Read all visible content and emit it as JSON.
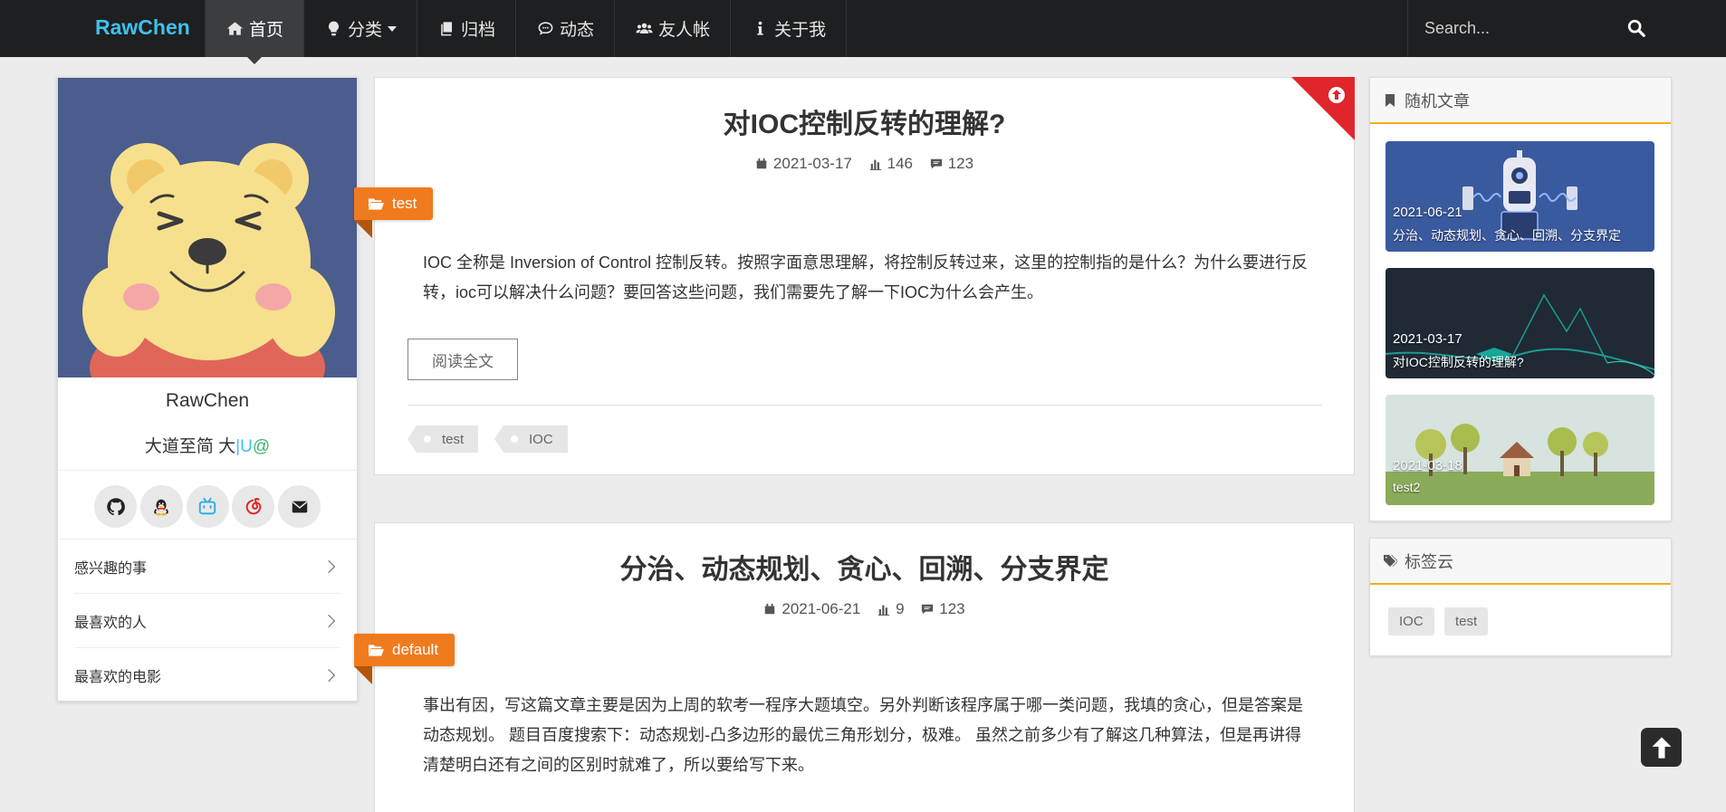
{
  "navbar": {
    "brand": "RawChen",
    "items": [
      {
        "label": "首页",
        "icon": "home-icon",
        "active": true
      },
      {
        "label": "分类",
        "icon": "lightbulb-icon",
        "dropdown": true
      },
      {
        "label": "归档",
        "icon": "archive-icon"
      },
      {
        "label": "动态",
        "icon": "comment-icon"
      },
      {
        "label": "友人帐",
        "icon": "users-icon"
      },
      {
        "label": "关于我",
        "icon": "info-icon"
      }
    ],
    "search_placeholder": "Search..."
  },
  "profile": {
    "name": "RawChen",
    "motto": "大道至简 大",
    "motto_cursor": "|U",
    "motto_at": "@",
    "social": [
      "github-icon",
      "qq-icon",
      "bilibili-icon",
      "netease-music-icon",
      "email-icon"
    ],
    "links": [
      "感兴趣的事",
      "最喜欢的人",
      "最喜欢的电影"
    ]
  },
  "posts": [
    {
      "title": "对IOC控制反转的理解?",
      "date": "2021-03-17",
      "views": "146",
      "comments": "123",
      "category": "test",
      "excerpt": "IOC 全称是 Inversion of Control 控制反转。按照字面意思理解，将控制反转过来，这里的控制指的是什么？为什么要进行反转，ioc可以解决什么问题？要回答这些问题，我们需要先了解一下IOC为什么会产生。",
      "read_more": "阅读全文",
      "tags": [
        "test",
        "IOC"
      ],
      "pinned": true
    },
    {
      "title": "分治、动态规划、贪心、回溯、分支界定",
      "date": "2021-06-21",
      "views": "9",
      "comments": "123",
      "category": "default",
      "excerpt": "事出有因，写这篇文章主要是因为上周的软考一程序大题填空。另外判断该程序属于哪一类问题，我填的贪心，但是答案是动态规划。 题目百度搜索下：动态规划-凸多边形的最优三角形划分，极难。 虽然之前多少有了解这几种算法，但是再讲得清楚明白还有之间的区别时就难了，所以要给写下来。"
    }
  ],
  "sidebar": {
    "random_title": "随机文章",
    "random_posts": [
      {
        "date": "2021-06-21",
        "title": "分治、动态规划、贪心、回溯、分支界定"
      },
      {
        "date": "2021-03-17",
        "title": "对IOC控制反转的理解?"
      },
      {
        "date": "2021-03-18",
        "title": "test2"
      }
    ],
    "tagcloud_title": "标签云",
    "tags": [
      "IOC",
      "test"
    ]
  },
  "colors": {
    "brand": "#3ec1ee",
    "category_ribbon": "#f07b1e",
    "pin_corner": "#e0262b",
    "widget_accent": "#f2b01e"
  }
}
